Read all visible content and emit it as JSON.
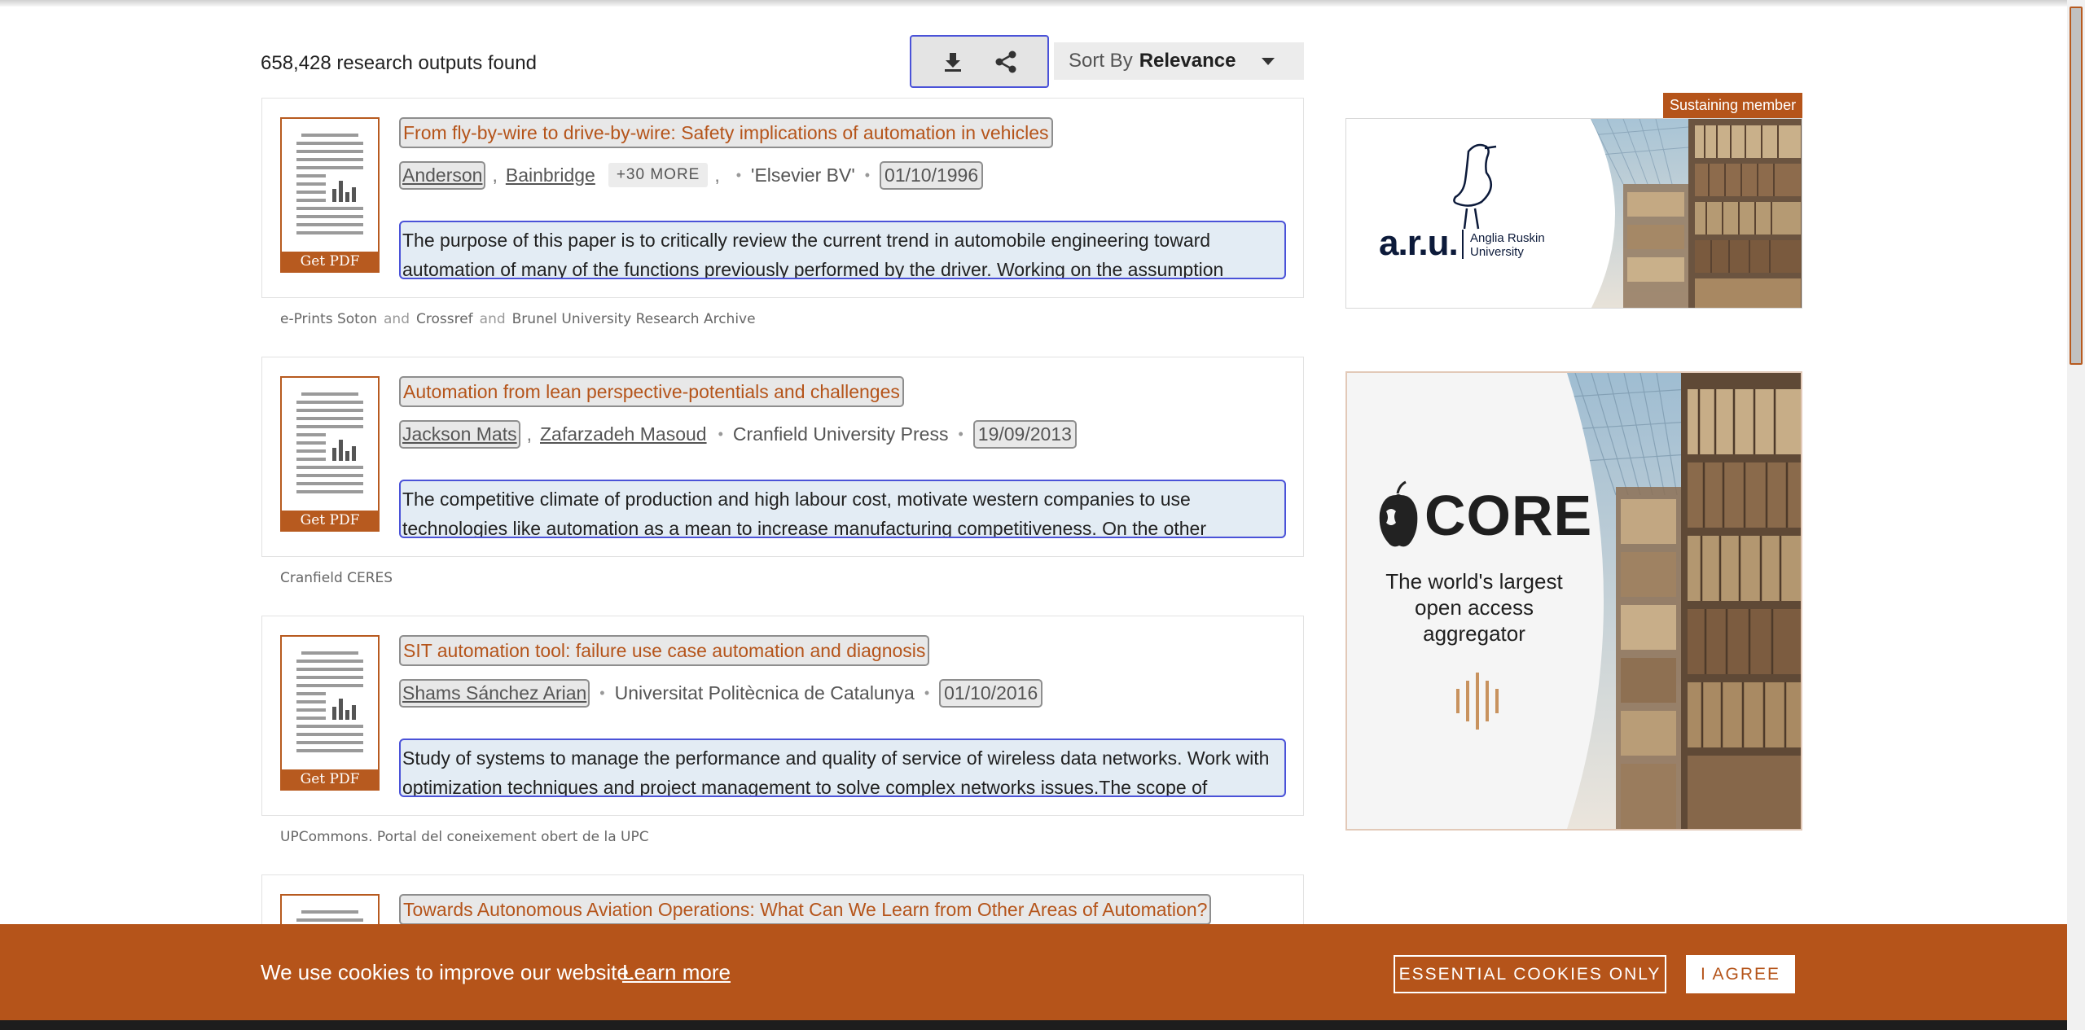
{
  "results": {
    "count_text": "658,428 research outputs found"
  },
  "toolbar": {
    "download_icon": "download-icon",
    "share_icon": "share-icon"
  },
  "sort": {
    "label": "Sort By",
    "value": "Relevance"
  },
  "items": [
    {
      "title": "From fly-by-wire to drive-by-wire: Safety implications of automation in vehicles",
      "authors": [
        "Anderson",
        "Bainbridge"
      ],
      "more": "+30 MORE",
      "publisher": "'Elsevier BV'",
      "date": "01/10/1996",
      "get_pdf": "Get PDF",
      "abstract": "The purpose of this paper is to critically review the current trend in automobile engineering toward automation of many of the functions previously performed by the driver. Working on the assumption",
      "sources": [
        "e-Prints Soton",
        "Crossref",
        "Brunel University Research Archive"
      ],
      "and": "and"
    },
    {
      "title": "Automation from lean perspective-potentials and challenges",
      "authors": [
        "Jackson Mats",
        "Zafarzadeh Masoud"
      ],
      "publisher": "Cranfield University Press",
      "date": "19/09/2013",
      "get_pdf": "Get PDF",
      "abstract": "The competitive climate of production and high labour cost, motivate western companies to use technologies like automation as a mean to increase manufacturing competitiveness. On the other",
      "sources": [
        "Cranfield CERES"
      ]
    },
    {
      "title": "SIT automation tool: failure use case automation and diagnosis",
      "authors": [
        "Shams Sánchez Arian"
      ],
      "publisher": "Universitat Politècnica de Catalunya",
      "date": "01/10/2016",
      "get_pdf": "Get PDF",
      "abstract": "Study of systems to manage the performance and quality of service of wireless data networks. Work with optimization techniques and project management to solve complex networks issues.The scope of",
      "sources": [
        "UPCommons. Portal del coneixement obert de la UPC"
      ]
    },
    {
      "title": "Towards Autonomous Aviation Operations: What Can We Learn from Other Areas of Automation?"
    }
  ],
  "ads": {
    "badge": "Sustaining member",
    "aru_logo_text": "a.r.u.",
    "aru_name_line1": "Anglia Ruskin",
    "aru_name_line2": "University",
    "core_logo_text": "CORE",
    "core_tagline_1": "The world's largest",
    "core_tagline_2": "open access",
    "core_tagline_3": "aggregator"
  },
  "cookie": {
    "message": "We use cookies to improve our website.",
    "learn_more": "Learn more",
    "essential": "ESSENTIAL COOKIES ONLY",
    "agree": "I AGREE"
  },
  "colors": {
    "accent": "#b5541a",
    "focus": "#4a52d8"
  }
}
